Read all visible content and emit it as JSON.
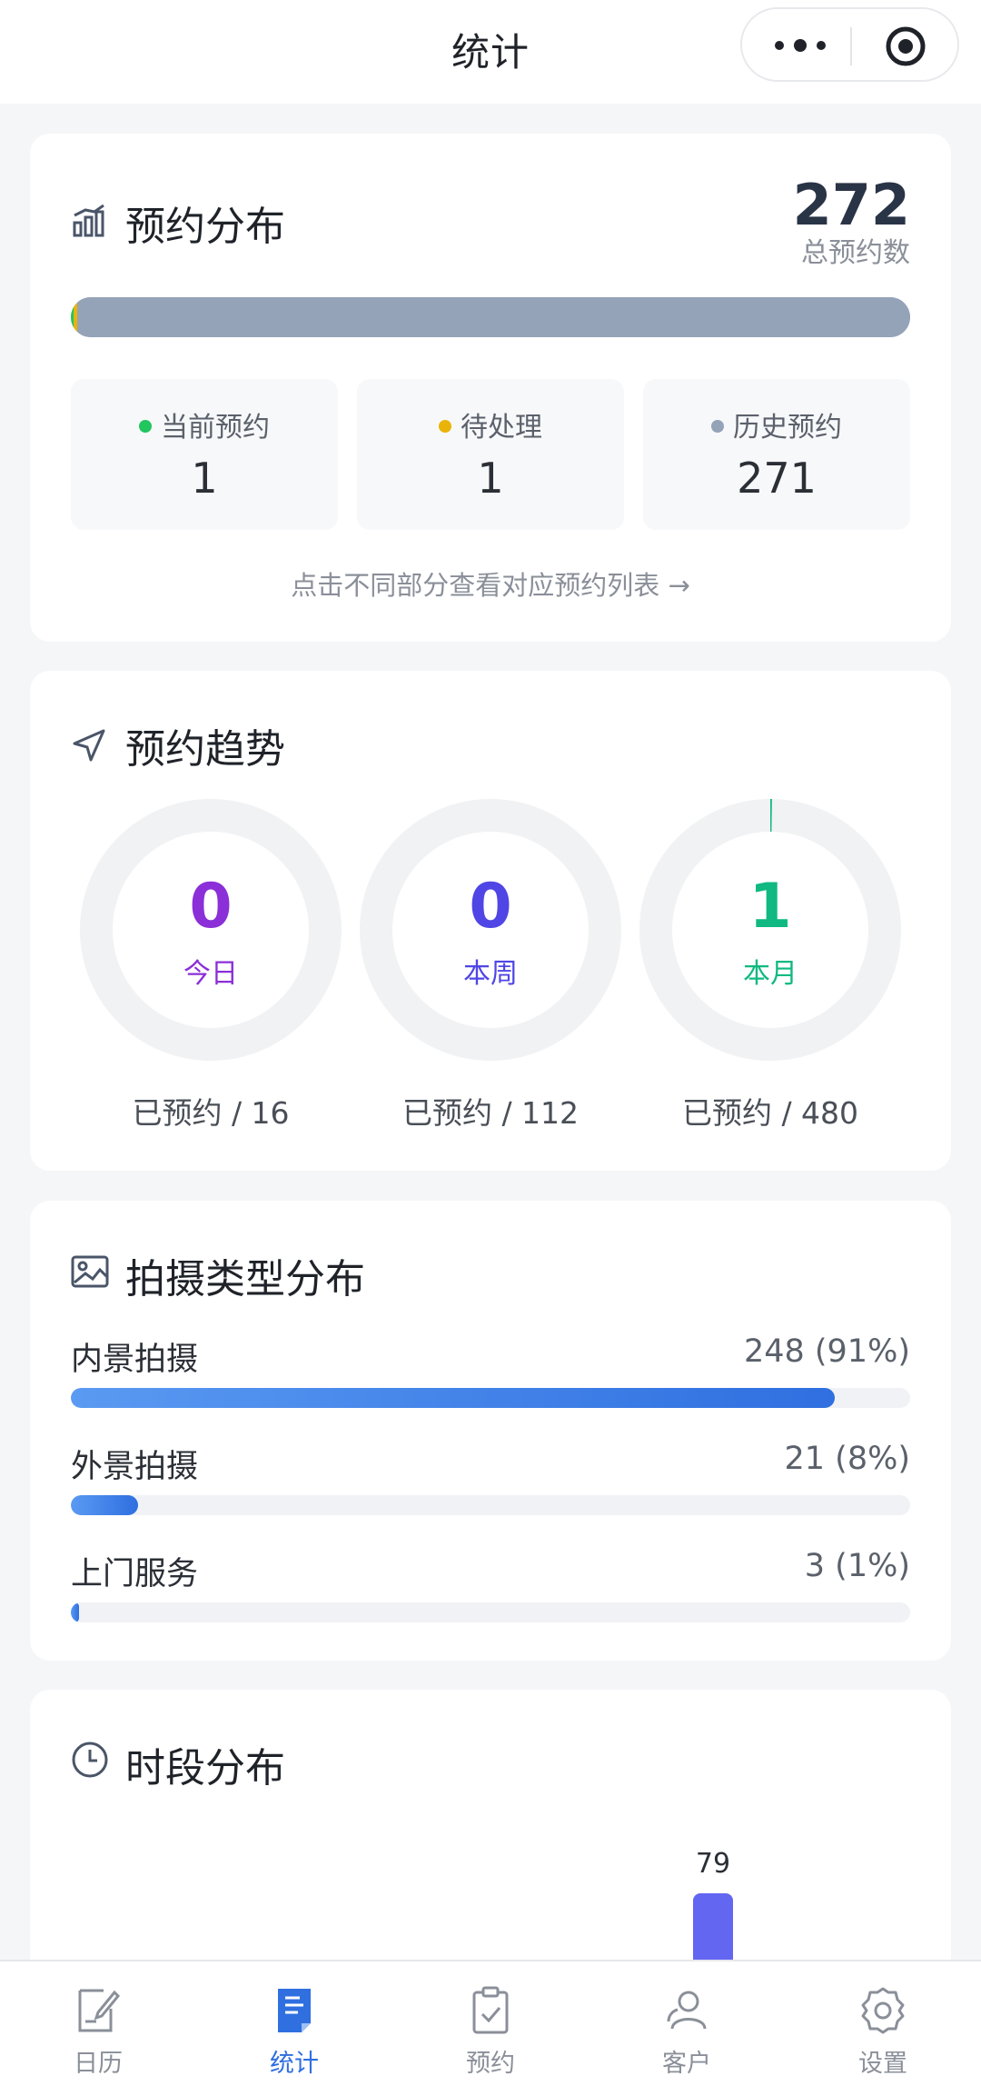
{
  "header": {
    "title": "统计"
  },
  "distribution": {
    "title": "预约分布",
    "total": "272",
    "total_label": "总预约数",
    "segments": [
      {
        "label": "当前预约",
        "value": "1",
        "count": 1,
        "color": "#22c55e"
      },
      {
        "label": "待处理",
        "value": "1",
        "count": 1,
        "color": "#eab308"
      },
      {
        "label": "历史预约",
        "value": "271",
        "count": 271,
        "color": "#94a3b8"
      }
    ],
    "hint": "点击不同部分查看对应预约列表 →"
  },
  "trend": {
    "title": "预约趋势",
    "items": [
      {
        "value": "0",
        "label": "今日",
        "footer": "已预约 / 16",
        "color": "#8b2fd8",
        "progress": 0
      },
      {
        "value": "0",
        "label": "本周",
        "footer": "已预约 / 112",
        "color": "#4f46e5",
        "progress": 0
      },
      {
        "value": "1",
        "label": "本月",
        "footer": "已预约 / 480",
        "color": "#10b981",
        "progress": 0.0021
      }
    ]
  },
  "types": {
    "title": "拍摄类型分布",
    "items": [
      {
        "name": "内景拍摄",
        "value": "248 (91%)",
        "percent": 91
      },
      {
        "name": "外景拍摄",
        "value": "21 (8%)",
        "percent": 8
      },
      {
        "name": "上门服务",
        "value": "3 (1%)",
        "percent": 1
      }
    ]
  },
  "hours": {
    "title": "时段分布",
    "visible_bar_value": "79",
    "bar_color": "#6366f1"
  },
  "tabbar": {
    "items": [
      {
        "label": "日历",
        "icon": "calendar-edit-icon",
        "active": false
      },
      {
        "label": "统计",
        "icon": "stats-document-icon",
        "active": true
      },
      {
        "label": "预约",
        "icon": "clipboard-check-icon",
        "active": false
      },
      {
        "label": "客户",
        "icon": "users-icon",
        "active": false
      },
      {
        "label": "设置",
        "icon": "gear-icon",
        "active": false
      }
    ]
  }
}
